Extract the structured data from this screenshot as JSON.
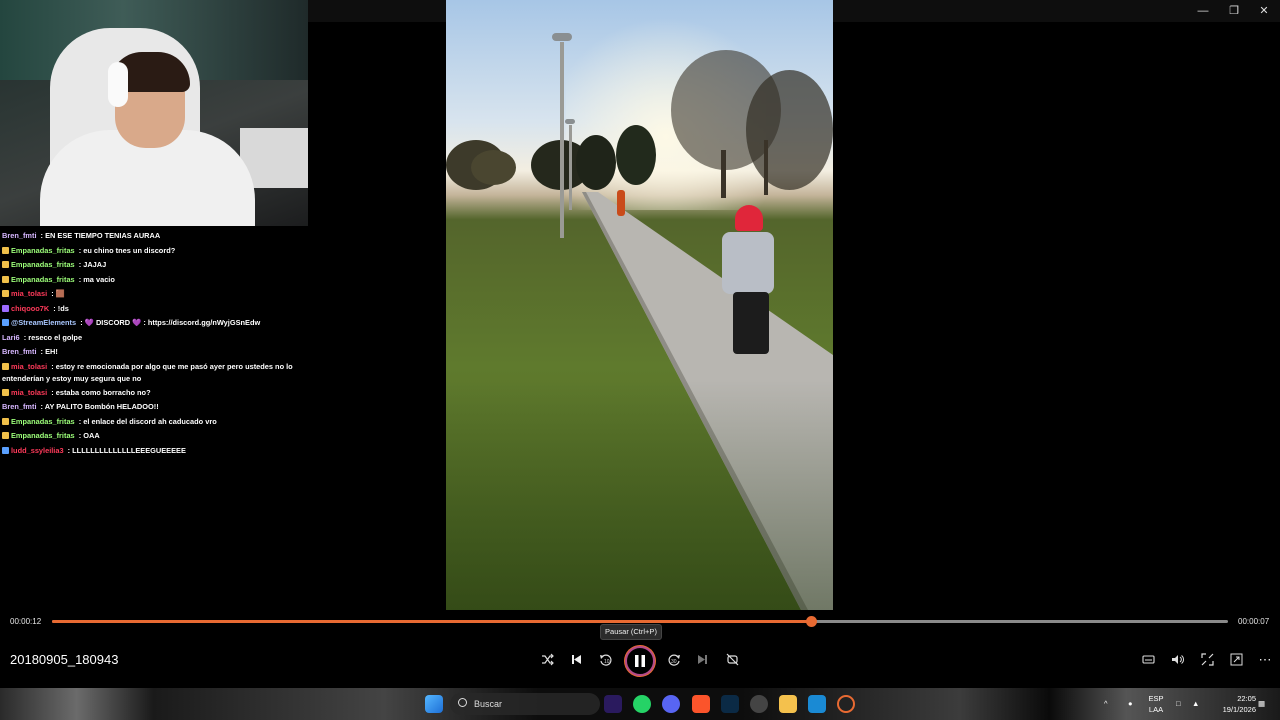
{
  "window": {
    "controls": [
      "minimize",
      "maximize",
      "close"
    ]
  },
  "chat": [
    {
      "user": "Bren_fmti",
      "color": "#d6b6ff",
      "badge": "",
      "message": " : EN ESE TIEMPO TENIAS AURAA"
    },
    {
      "user": "Empanadas_fritas",
      "color": "#9dff7a",
      "badge": "#f0c04a",
      "message": " : eu chino tnes un discord?"
    },
    {
      "user": "Empanadas_fritas",
      "color": "#9dff7a",
      "badge": "#f0c04a",
      "message": " : JAJAJ"
    },
    {
      "user": "Empanadas_fritas",
      "color": "#9dff7a",
      "badge": "#f0c04a",
      "message": " : ma vacio"
    },
    {
      "user": "mia_tolasi",
      "color": "#ff3a5a",
      "badge": "#f0c04a",
      "message": " : 🟫"
    },
    {
      "user": "chiqooo7K",
      "color": "#ff3a5a",
      "badge": "#9d6bff",
      "message": " : !ds"
    },
    {
      "user": "@StreamElements",
      "color": "#a9c7ff",
      "badge": "#5aa0ff",
      "message": " : 💜 DISCORD 💜 : https://discord.gg/nWyjGSnEdw"
    },
    {
      "user": "Lari6",
      "color": "#d6b6ff",
      "badge": "",
      "message": " : reseco el golpe"
    },
    {
      "user": "Bren_fmti",
      "color": "#d6b6ff",
      "badge": "",
      "message": " : EH!"
    },
    {
      "user": "mia_tolasi",
      "color": "#ff3a5a",
      "badge": "#f0c04a",
      "message": " : estoy re emocionada por algo que me pasó ayer pero ustedes no lo entenderían y estoy muy segura que no",
      "wrap": true
    },
    {
      "user": "mia_tolasi",
      "color": "#ff3a5a",
      "badge": "#f0c04a",
      "message": " : estaba como borracho no?"
    },
    {
      "user": "Bren_fmti",
      "color": "#d6b6ff",
      "badge": "",
      "message": " : AY PALITO Bombón HELADOO!!"
    },
    {
      "user": "Empanadas_fritas",
      "color": "#9dff7a",
      "badge": "#f0c04a",
      "message": " : el enlace del discord ah caducado vro"
    },
    {
      "user": "Empanadas_fritas",
      "color": "#9dff7a",
      "badge": "#f0c04a",
      "message": " : OAA"
    },
    {
      "user": "ludd_ssyleilia3",
      "color": "#ff3a5a",
      "badge": "#5aa0ff",
      "message": " : LLLLLLLLLLLLLLEEEGUEEEEE"
    }
  ],
  "player": {
    "current_time": "00:00:12",
    "total_time": "00:00:07",
    "progress": 0.645,
    "filename": "20180905_180943",
    "tooltip": "Pausar (Ctrl+P)",
    "accent": "#e86a32"
  },
  "taskbar": {
    "search_placeholder": "Buscar",
    "language": "ESP",
    "layout": "LAA",
    "time": "22:05",
    "date": "19/1/2026"
  }
}
